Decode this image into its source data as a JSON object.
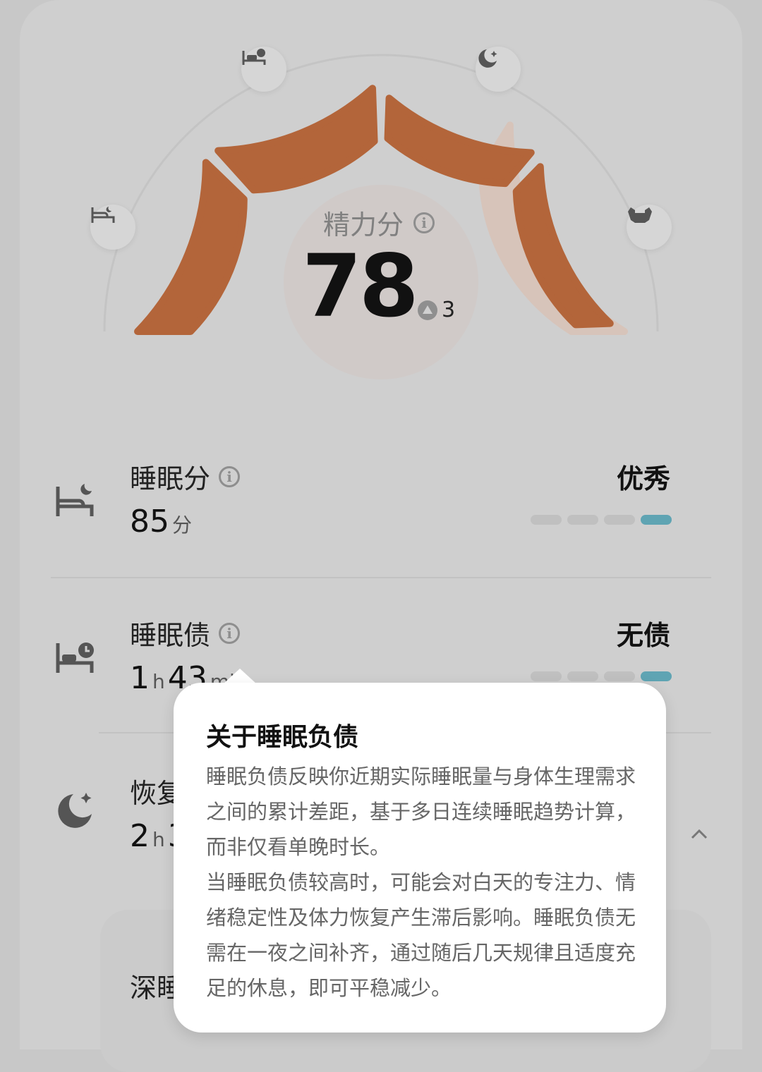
{
  "energy": {
    "label": "精力分",
    "score": "78",
    "delta": "3",
    "gauge_fill": 0.78,
    "arc_color": "#b3653a",
    "stage_icons": [
      "bed-icon",
      "bed-sleep-icon",
      "moon-star-icon",
      "muscle-icon"
    ]
  },
  "metrics": [
    {
      "title": "睡眠分",
      "value": "85",
      "unit": "分",
      "status": "优秀",
      "level": 4,
      "icon": "bed-moon-icon"
    },
    {
      "title": "睡眠债",
      "value_h": "1",
      "unit_h": "h",
      "value_m": "43",
      "unit_m": "min",
      "status": "无债",
      "level": 4,
      "icon": "bed-clock-icon"
    },
    {
      "title": "恢复",
      "value_h": "2",
      "unit_h": "h",
      "value_m": "3",
      "icon": "moon-star-icon"
    }
  ],
  "subcard": {
    "label": "深睡"
  },
  "popup": {
    "title": "关于睡眠负债",
    "paragraph1": "睡眠负债反映你近期实际睡眠量与身体生理需求之间的累计差距，基于多日连续睡眠趋势计算，而非仅看单晚时长。",
    "paragraph2": "当睡眠负债较高时，可能会对白天的专注力、情绪稳定性及体力恢复产生滞后影响。睡眠负债无需在一夜之间补齐，通过随后几天规律且适度充足的休息，即可平稳减少。"
  },
  "colors": {
    "bar_active": "#5fa4b3",
    "bar_inactive": "#c0c0c0"
  }
}
